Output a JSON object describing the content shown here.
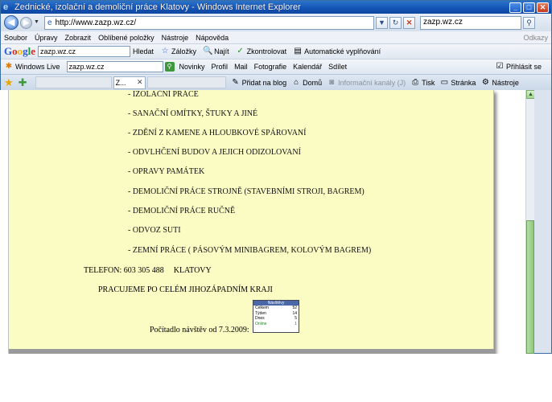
{
  "window": {
    "title": "Zednické, izolační a demoliční práce Klatovy - Windows Internet Explorer"
  },
  "address": {
    "url": "http://www.zazp.wz.cz/",
    "search_value": "zazp.wz.cz"
  },
  "menu": {
    "items": [
      "Soubor",
      "Úpravy",
      "Zobrazit",
      "Oblíbené položky",
      "Nástroje",
      "Nápověda"
    ],
    "right": "Odkazy"
  },
  "google_toolbar": {
    "search_value": "zazp.wz.cz",
    "items": [
      "Hledat",
      "Záložky",
      "Najít",
      "Zkontrolovat",
      "Automatické vyplňování"
    ]
  },
  "live_toolbar": {
    "brand": "Windows Live",
    "search_value": "zazp.wz.cz",
    "items": [
      "Novinky",
      "Profil",
      "Mail",
      "Fotografie",
      "Kalendář",
      "Sdílet"
    ],
    "signin": "Přihlásit se"
  },
  "tabs": {
    "active_label": "Z...",
    "commands": [
      "Přidat na blog",
      "Domů",
      "Informační kanály (J)",
      "Tisk",
      "Stránka",
      "Nástroje"
    ]
  },
  "content": {
    "services": [
      "- IZOLAČNÍ PRÁCE",
      "- SANAČNÍ OMÍTKY, ŠTUKY A JINÉ",
      "- ZDĚNÍ Z KAMENE A HLOUBKOVÉ SPÁROVANÍ",
      "- ODVLHČENÍ BUDOV A JEJICH ODIZOLOVANÍ",
      "- OPRAVY PAMÁTEK",
      "- DEMOLIČNÍ PRÁCE STROJNĚ (STAVEBNÍMI STROJI, BAGREM)",
      "- DEMOLIČNÍ PRÁCE RUČNĚ",
      "- ODVOZ SUTI",
      "- ZEMNÍ PRÁCE ( PÁSOVÝM MINIBAGREM, KOLOVÝM BAGREM)"
    ],
    "phone": "TELEFON: 603 305 488",
    "city": "KLATOVY",
    "region": "PRACUJEME PO CELÉM JIHOZÁPADNÍM KRAJI",
    "counter_label": "Počítadlo návštěv od 7.3.2009:"
  },
  "counter": {
    "title": "Návštěvy",
    "rows": [
      {
        "label": "Celkem",
        "value": "52"
      },
      {
        "label": "Týden",
        "value": "14"
      },
      {
        "label": "Dnes",
        "value": "5"
      },
      {
        "label": "Online",
        "value": "1"
      }
    ]
  }
}
